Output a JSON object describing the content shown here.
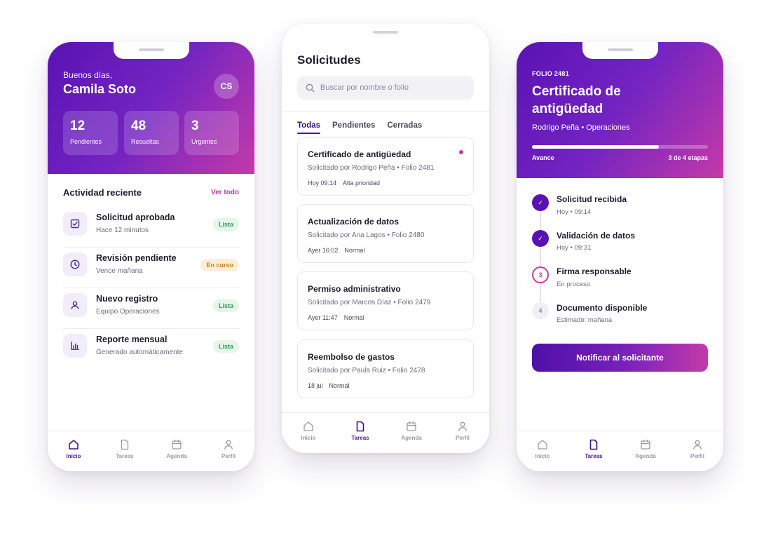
{
  "colors": {
    "brand_start": "#5a13b3",
    "brand_end": "#c43aa8",
    "success": "#2f9a57",
    "warning": "#c7801d"
  },
  "home": {
    "greeting": "Buenos días,",
    "user_name": "Camila Soto",
    "avatar_initials": "CS",
    "stats": [
      {
        "value": "12",
        "label": "Pendientes"
      },
      {
        "value": "48",
        "label": "Resueltas"
      },
      {
        "value": "3",
        "label": "Urgentes"
      }
    ],
    "activity_title": "Actividad reciente",
    "see_all": "Ver todo",
    "activity": [
      {
        "title": "Solicitud aprobada",
        "subtitle": "Hace 12 minutos",
        "status": "Lista",
        "icon": "check-square-icon"
      },
      {
        "title": "Revisión pendiente",
        "subtitle": "Vence mañana",
        "status": "En curso",
        "icon": "clock-icon"
      },
      {
        "title": "Nuevo registro",
        "subtitle": "Equipo Operaciones",
        "status": "Lista",
        "icon": "user-icon"
      },
      {
        "title": "Reporte mensual",
        "subtitle": "Generado automáticamente",
        "status": "Lista",
        "icon": "bar-chart-icon"
      }
    ]
  },
  "tabbar": [
    {
      "label": "Inicio",
      "icon": "home-icon"
    },
    {
      "label": "Tareas",
      "icon": "document-icon"
    },
    {
      "label": "Agenda",
      "icon": "calendar-icon"
    },
    {
      "label": "Perfil",
      "icon": "user-icon"
    }
  ],
  "requests": {
    "title": "Solicitudes",
    "search_placeholder": "Buscar por nombre o folio",
    "filters": [
      "Todas",
      "Pendientes",
      "Cerradas"
    ],
    "active_filter": "Todas",
    "items": [
      {
        "title": "Certificado de antigüedad",
        "requested": "Solicitado por Rodrigo Peña • Folio 2481",
        "time": "Hoy 09:14",
        "priority": "Alta prioridad",
        "unread": true
      },
      {
        "title": "Actualización de datos",
        "requested": "Solicitado por Ana Lagos • Folio 2480",
        "time": "Ayer 16:02",
        "priority": "Normal",
        "unread": false
      },
      {
        "title": "Permiso administrativo",
        "requested": "Solicitado por Marcos Díaz • Folio 2479",
        "time": "Ayer 11:47",
        "priority": "Normal",
        "unread": false
      },
      {
        "title": "Reembolso de gastos",
        "requested": "Solicitado por Paula Ruiz • Folio 2478",
        "time": "18 jul",
        "priority": "Normal",
        "unread": false
      }
    ]
  },
  "detail": {
    "folio": "FOLIO 2481",
    "title": "Certificado de antigüedad",
    "requester": "Rodrigo Peña • Operaciones",
    "progress_label": "Avance",
    "progress_stage": "3 de 4 etapas",
    "progress_fraction": 0.72,
    "steps": [
      {
        "marker": "✓",
        "name": "Solicitud recibida",
        "sub": "Hoy • 09:14",
        "state": "done"
      },
      {
        "marker": "✓",
        "name": "Validación de datos",
        "sub": "Hoy • 09:31",
        "state": "done"
      },
      {
        "marker": "3",
        "name": "Firma responsable",
        "sub": "En proceso",
        "state": "current"
      },
      {
        "marker": "4",
        "name": "Documento disponible",
        "sub": "Estimado: mañana",
        "state": "todo"
      }
    ],
    "cta": "Notificar al solicitante"
  }
}
